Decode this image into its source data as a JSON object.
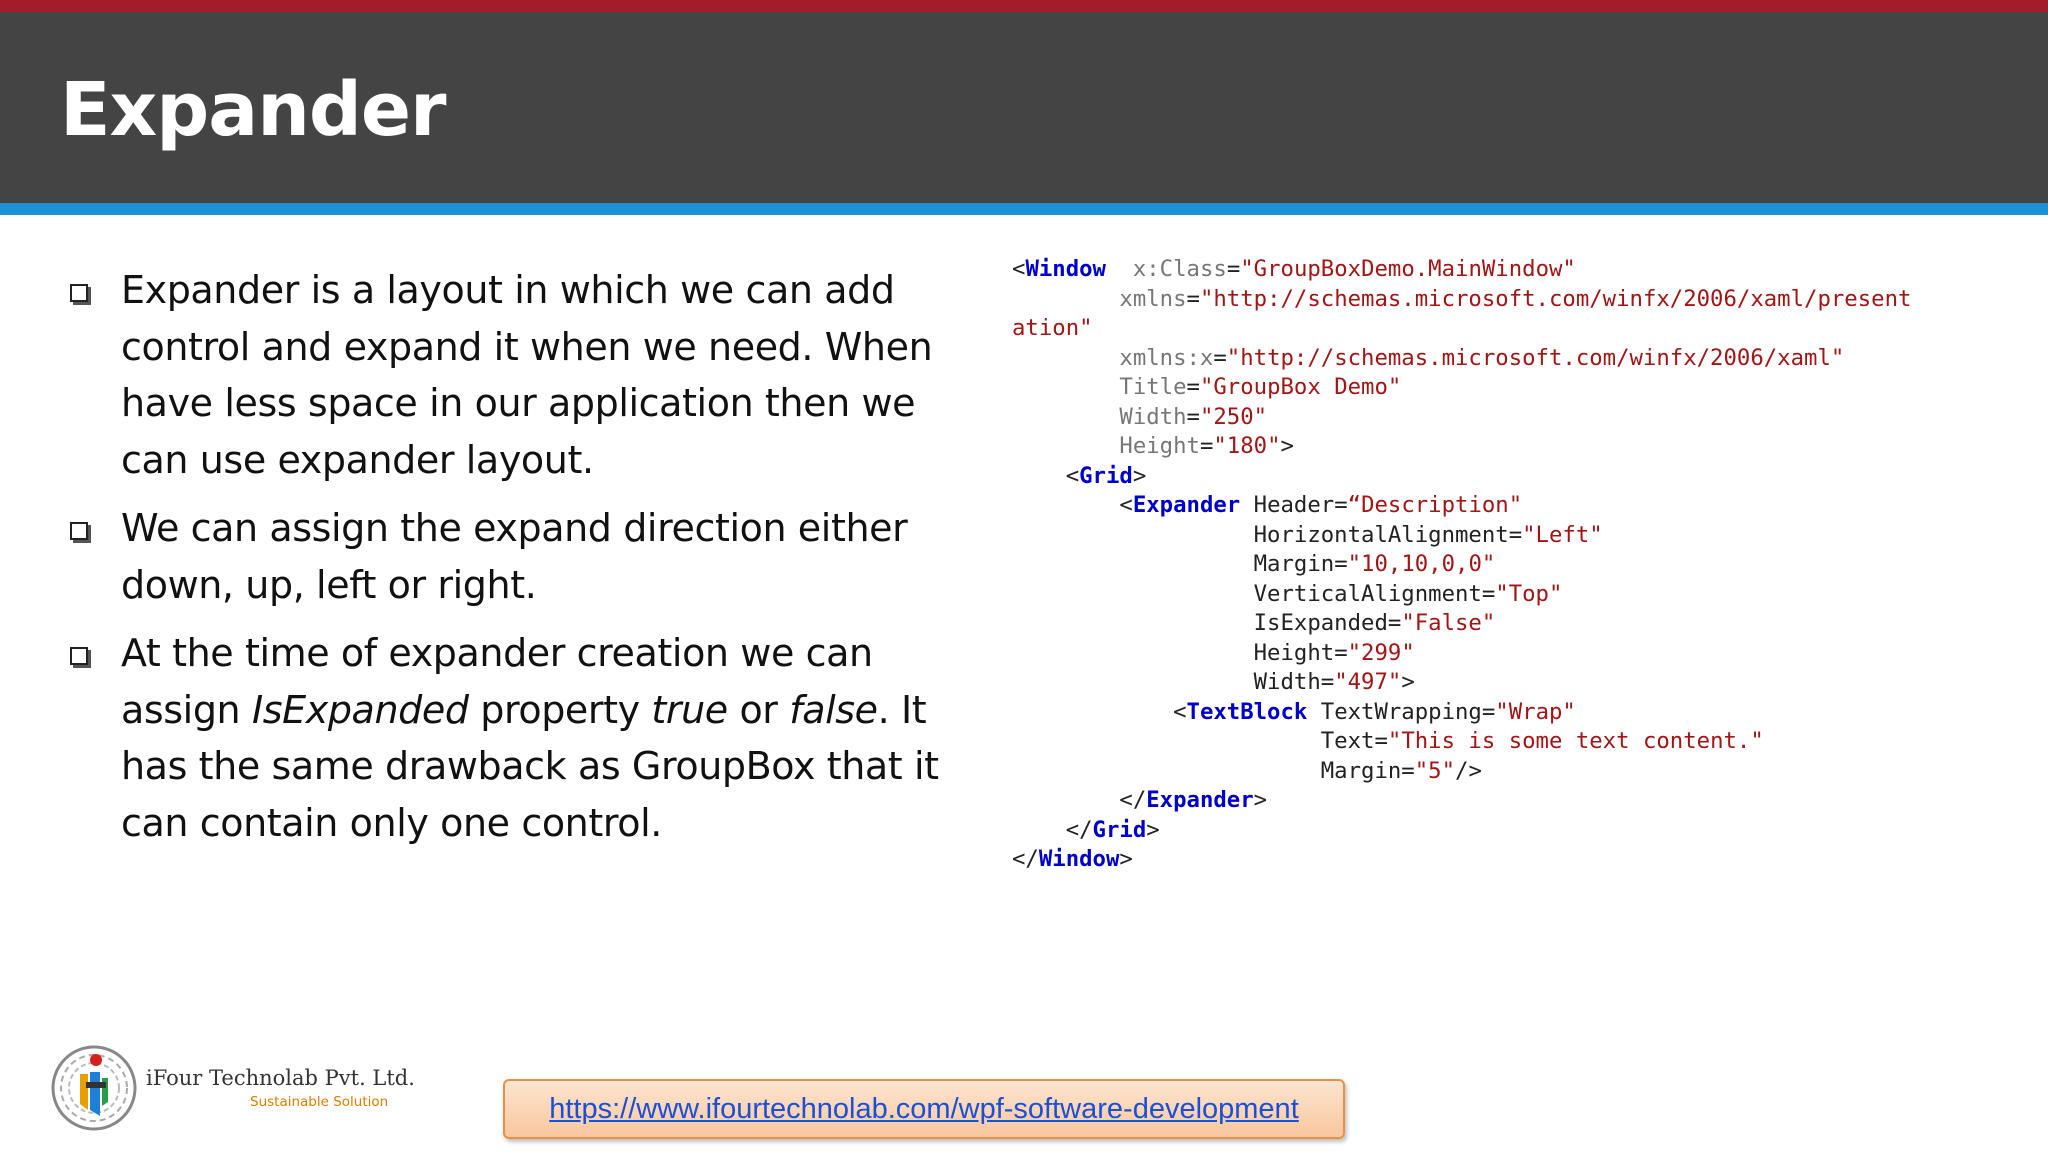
{
  "slide": {
    "title": "Expander"
  },
  "bullets": [
    {
      "parts": [
        {
          "text": "Expander is a layout in which we can add control and expand it when we need. When have less space in our application then we can use expander layout.",
          "italic": false
        }
      ]
    },
    {
      "parts": [
        {
          "text": "We can assign the expand direction either down, up, left or right.",
          "italic": false
        }
      ]
    },
    {
      "parts": [
        {
          "text": " At the time of expander creation we can assign ",
          "italic": false
        },
        {
          "text": "IsExpanded",
          "italic": true
        },
        {
          "text": " property ",
          "italic": false
        },
        {
          "text": "true",
          "italic": true
        },
        {
          "text": " or ",
          "italic": false
        },
        {
          "text": "false",
          "italic": true
        },
        {
          "text": ". It has the same drawback as GroupBox that it can contain only one control.",
          "italic": false
        }
      ]
    }
  ],
  "code_lines": [
    [
      {
        "t": "<",
        "c": "punc"
      },
      {
        "t": "Window",
        "c": "tag"
      },
      {
        "t": "  x:Class",
        "c": "attr"
      },
      {
        "t": "=",
        "c": "punc"
      },
      {
        "t": "\"GroupBoxDemo.MainWindow\"",
        "c": "val"
      }
    ],
    [
      {
        "t": "        xmlns",
        "c": "attr"
      },
      {
        "t": "=",
        "c": "punc"
      },
      {
        "t": "\"http://schemas.microsoft.com/winfx/2006/xaml/present",
        "c": "val"
      }
    ],
    [
      {
        "t": "ation\"",
        "c": "val"
      }
    ],
    [
      {
        "t": "        xmlns:x",
        "c": "attr"
      },
      {
        "t": "=",
        "c": "punc"
      },
      {
        "t": "\"http://schemas.microsoft.com/winfx/2006/xaml\"",
        "c": "val"
      }
    ],
    [
      {
        "t": "        Title",
        "c": "attr"
      },
      {
        "t": "=",
        "c": "punc"
      },
      {
        "t": "\"GroupBox Demo\"",
        "c": "val"
      }
    ],
    [
      {
        "t": "        Width",
        "c": "attr"
      },
      {
        "t": "=",
        "c": "punc"
      },
      {
        "t": "\"250\"",
        "c": "val"
      }
    ],
    [
      {
        "t": "        Height",
        "c": "attr"
      },
      {
        "t": "=",
        "c": "punc"
      },
      {
        "t": "\"180\"",
        "c": "val"
      },
      {
        "t": ">",
        "c": "punc"
      }
    ],
    [
      {
        "t": "    <",
        "c": "punc"
      },
      {
        "t": "Grid",
        "c": "tag"
      },
      {
        "t": ">",
        "c": "punc"
      }
    ],
    [
      {
        "t": "        <",
        "c": "punc"
      },
      {
        "t": "Expander",
        "c": "tag"
      },
      {
        "t": " Header",
        "c": "attr-dark"
      },
      {
        "t": "=",
        "c": "punc"
      },
      {
        "t": "“Description\"",
        "c": "val"
      }
    ],
    [
      {
        "t": "                  HorizontalAlignment",
        "c": "attr-dark"
      },
      {
        "t": "=",
        "c": "punc"
      },
      {
        "t": "\"Left\"",
        "c": "val"
      }
    ],
    [
      {
        "t": "                  Margin",
        "c": "attr-dark"
      },
      {
        "t": "=",
        "c": "punc"
      },
      {
        "t": "\"10,10,0,0\"",
        "c": "val"
      }
    ],
    [
      {
        "t": "                  VerticalAlignment",
        "c": "attr-dark"
      },
      {
        "t": "=",
        "c": "punc"
      },
      {
        "t": "\"Top\"",
        "c": "val"
      }
    ],
    [
      {
        "t": "                  IsExpanded",
        "c": "attr-dark"
      },
      {
        "t": "=",
        "c": "punc"
      },
      {
        "t": "\"False\"",
        "c": "val"
      }
    ],
    [
      {
        "t": "                  Height",
        "c": "attr-dark"
      },
      {
        "t": "=",
        "c": "punc"
      },
      {
        "t": "\"299\"",
        "c": "val"
      }
    ],
    [
      {
        "t": "                  Width",
        "c": "attr-dark"
      },
      {
        "t": "=",
        "c": "punc"
      },
      {
        "t": "\"497\"",
        "c": "val"
      },
      {
        "t": ">",
        "c": "punc"
      }
    ],
    [
      {
        "t": "            <",
        "c": "punc"
      },
      {
        "t": "TextBlock",
        "c": "tag"
      },
      {
        "t": " TextWrapping",
        "c": "attr-dark"
      },
      {
        "t": "=",
        "c": "punc"
      },
      {
        "t": "\"Wrap\"",
        "c": "val"
      }
    ],
    [
      {
        "t": "                       Text",
        "c": "attr-dark"
      },
      {
        "t": "=",
        "c": "punc"
      },
      {
        "t": "\"This is some text content.\"",
        "c": "val"
      }
    ],
    [
      {
        "t": "                       Margin",
        "c": "attr-dark"
      },
      {
        "t": "=",
        "c": "punc"
      },
      {
        "t": "\"5\"",
        "c": "val"
      },
      {
        "t": "/>",
        "c": "punc"
      }
    ],
    [
      {
        "t": "        </",
        "c": "punc"
      },
      {
        "t": "Expander",
        "c": "tag"
      },
      {
        "t": ">",
        "c": "punc"
      }
    ],
    [
      {
        "t": "    </",
        "c": "punc"
      },
      {
        "t": "Grid",
        "c": "tag"
      },
      {
        "t": ">",
        "c": "punc"
      }
    ],
    [
      {
        "t": "</",
        "c": "punc"
      },
      {
        "t": "Window",
        "c": "tag"
      },
      {
        "t": ">",
        "c": "punc"
      }
    ]
  ],
  "footer": {
    "company_name": "iFour Technolab Pvt. Ltd.",
    "tagline": "Sustainable Solution",
    "url": "https://www.ifourtechnolab.com/wpf-software-development",
    "logo_icon": "ifour-logo-icon"
  },
  "colors": {
    "top_stripe": "#a21c2c",
    "title_bar": "#444444",
    "blue_stripe": "#1e90d6",
    "code_tag": "#0000cc",
    "code_value": "#a31515",
    "link": "#1a4fd6"
  }
}
